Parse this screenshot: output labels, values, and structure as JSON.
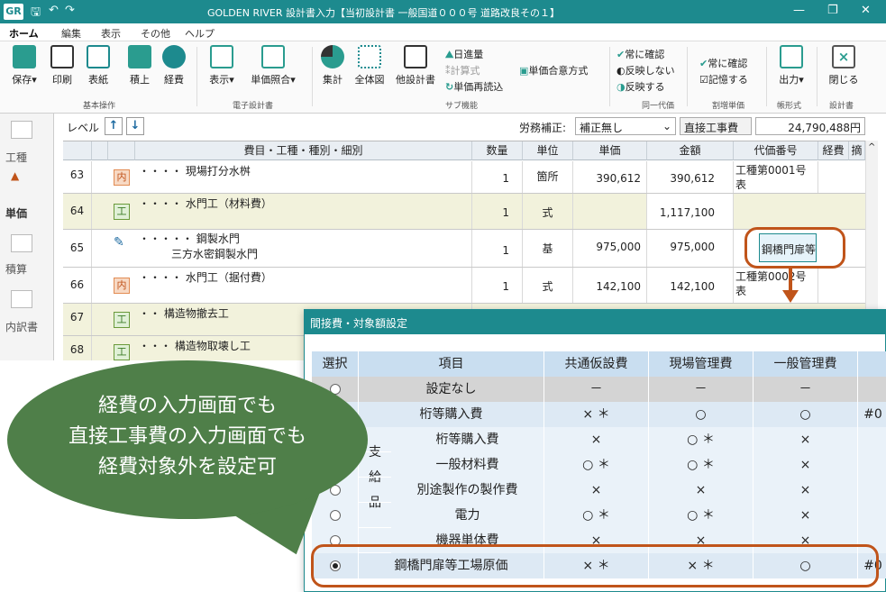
{
  "titlebar": {
    "logo": "GR",
    "title": "GOLDEN RIVER 設計書入力【当初設計書 一般国道０００号 道路改良その１】",
    "min": "—",
    "restore": "❐",
    "close": "✕"
  },
  "menu": {
    "tabs": [
      "ホーム",
      "編集",
      "表示",
      "その他",
      "ヘルプ"
    ]
  },
  "ribbon": {
    "save": "保存",
    "print": "印刷",
    "cover": "表紙",
    "seki": "積上",
    "cost": "経費",
    "group_basic": "基本操作",
    "view": "表示",
    "unit_ref": "単価照合",
    "group_e": "電子設計書",
    "sum": "集計",
    "all": "全体図",
    "other": "他設計書",
    "daily": "日進量",
    "calc": "計算式",
    "unit_read": "単価再読込",
    "unit_mix": "単価合意方式",
    "group_sub": "サブ機能",
    "always1": "常に確認",
    "no_reflect": "反映しない",
    "reflect": "反映する",
    "group_same": "同一代価",
    "always2": "常に確認",
    "remember": "記憶する",
    "group_ratio": "割増単価",
    "output": "出力",
    "group_form": "帳形式",
    "close": "閉じる",
    "group_doc": "設計書"
  },
  "leftnav": [
    "工種",
    "単価",
    "積算",
    "内訳書"
  ],
  "toolbar": {
    "level": "レベル",
    "labor_label": "労務補正:",
    "labor_value": "補正無し",
    "direct_label": "直接工事費",
    "direct_value": "24,790,488円"
  },
  "grid": {
    "headers": [
      "",
      "",
      "",
      "費目・工種・種別・細別",
      "数量",
      "単位",
      "単価",
      "金額",
      "代価番号",
      "経費",
      "摘"
    ],
    "rows": [
      {
        "no": "63",
        "tag": "内",
        "name": "現場打分水桝",
        "qty": "1",
        "unit": "箇所",
        "price": "390,612",
        "amount": "390,612",
        "code": "工種第0001号表",
        "cost": ""
      },
      {
        "no": "64",
        "tag": "工",
        "name": "水門工（材料費）",
        "qty": "1",
        "unit": "式",
        "price": "",
        "amount": "1,117,100",
        "code": "",
        "cost": ""
      },
      {
        "no": "65",
        "tag": "",
        "name": "鋼製水門",
        "name2": "三方水密鋼製水門",
        "qty": "1",
        "unit": "基",
        "price": "975,000",
        "amount": "975,000",
        "code": "",
        "cost": "鋼橋門扉等"
      },
      {
        "no": "66",
        "tag": "内",
        "name": "水門工（据付費）",
        "qty": "1",
        "unit": "式",
        "price": "142,100",
        "amount": "142,100",
        "code": "工種第0002号表",
        "cost": ""
      },
      {
        "no": "67",
        "tag": "工",
        "name": "構造物撤去工",
        "qty": "",
        "unit": "",
        "price": "",
        "amount": "",
        "code": "",
        "cost": ""
      },
      {
        "no": "68",
        "tag": "工",
        "name": "構造物取壊し工",
        "qty": "",
        "unit": "",
        "price": "",
        "amount": "",
        "code": "",
        "cost": ""
      }
    ]
  },
  "callout": {
    "line1": "経費の入力画面でも",
    "line2": "直接工事費の入力画面でも",
    "line3": "経費対象外を設定可"
  },
  "dialog": {
    "title": "間接費・対象額設定",
    "headers": [
      "選択",
      "項目",
      "共通仮設費",
      "現場管理費",
      "一般管理費"
    ],
    "rows": [
      {
        "item": "設定なし",
        "c1": "－",
        "c2": "－",
        "c3": "－",
        "extra": ""
      },
      {
        "item": "桁等購入費",
        "c1": "× ＊",
        "c2": "○",
        "c3": "○",
        "extra": "#0"
      },
      {
        "item": "桁等購入費",
        "c1": "×",
        "c2": "○ ＊",
        "c3": "×",
        "extra": ""
      },
      {
        "item": "一般材料費",
        "c1": "○ ＊",
        "c2": "○ ＊",
        "c3": "×",
        "extra": ""
      },
      {
        "item": "別途製作の製作費",
        "c1": "×",
        "c2": "×",
        "c3": "×",
        "extra": ""
      },
      {
        "item": "電力",
        "c1": "○ ＊",
        "c2": "○ ＊",
        "c3": "×",
        "extra": ""
      },
      {
        "item": "機器単体費",
        "c1": "×",
        "c2": "×",
        "c3": "×",
        "extra": ""
      },
      {
        "item": "鋼橋門扉等工場原価",
        "c1": "× ＊",
        "c2": "× ＊",
        "c3": "○",
        "extra": "#0"
      }
    ],
    "group": [
      "支",
      "給",
      "品"
    ]
  }
}
